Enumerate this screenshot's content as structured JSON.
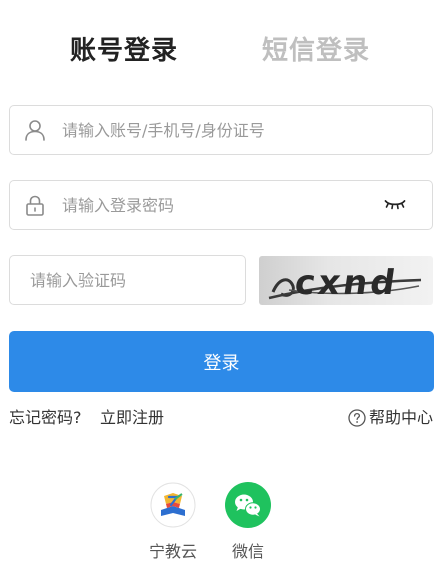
{
  "tabs": {
    "account_login": "账号登录",
    "sms_login": "短信登录"
  },
  "form": {
    "account_placeholder": "请输入账号/手机号/身份证号",
    "password_placeholder": "请输入登录密码",
    "captcha_placeholder": "请输入验证码",
    "captcha_text": "cxnd",
    "login_button": "登录"
  },
  "links": {
    "forgot_password": "忘记密码?",
    "register": "立即注册",
    "help_center": "帮助中心"
  },
  "third_party": [
    {
      "label": "宁教云",
      "icon": "ningjiaoyun-logo-icon"
    },
    {
      "label": "微信",
      "icon": "wechat-icon"
    }
  ],
  "colors": {
    "primary": "#2d8ae8",
    "tab_active_underline": "#8ec3f5",
    "tab_inactive": "#bfbfbf",
    "wechat_green": "#1fc25e",
    "border": "#dcdcdc"
  },
  "icons": {
    "account": "user-icon",
    "password": "lock-icon",
    "eye": "eye-closed-icon",
    "help": "question-circle-icon"
  }
}
